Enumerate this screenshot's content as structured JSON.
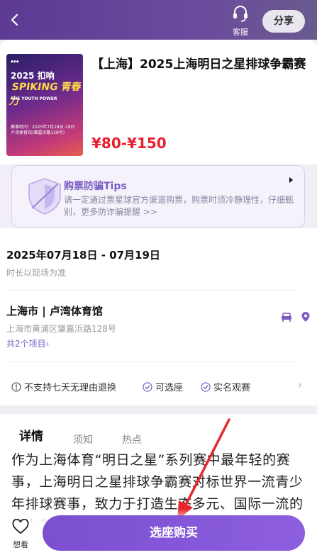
{
  "header": {
    "customer_service_label": "客服",
    "share_label": "分享"
  },
  "event": {
    "title": "【上海】2025上海明日之星排球争霸赛",
    "price": "¥80-¥150",
    "poster": {
      "line1": "2025 扣响",
      "line2": "SPIKING 青春力",
      "line3": "THE YOUTH POWER",
      "info": "赛事时间：2025年7月18日-19日\n卢湾体育馆(肇嘉浜路128号)"
    }
  },
  "tips": {
    "title": "购票防骗Tips",
    "desc": "请一定通过票星球官方渠道购票，购票时须冷静理性，仔细甄别，更多防诈骗提醒 >>"
  },
  "schedule": {
    "date": "2025年07月18日 - 07月19日",
    "duration_note": "时长以现场为准"
  },
  "venue": {
    "name": "上海市 | 卢湾体育馆",
    "address": "上海市黄浦区肇嘉浜路128号",
    "items": "共2个项目›"
  },
  "services": [
    {
      "label": "不支持七天无理由退换",
      "icon": "warning-icon"
    },
    {
      "label": "可选座",
      "icon": "check-circle-icon"
    },
    {
      "label": "实名观赛",
      "icon": "check-circle-icon"
    }
  ],
  "tabs": {
    "detail": "详情",
    "notice": "须知",
    "hot": "热点"
  },
  "detail_text": "作为上海体育“明日之星”系列赛中最年轻的赛事，上海明日之星排球争霸赛对标世界一流青少年排球赛事，致力于打造生态多元、国际一流的青少年排球赛事",
  "bottom": {
    "want_label": "想看",
    "buy_label": "选座购买"
  },
  "colors": {
    "brand": "#7b4fd0",
    "price": "#e81f2c",
    "header_bg": "#5d3a93"
  }
}
